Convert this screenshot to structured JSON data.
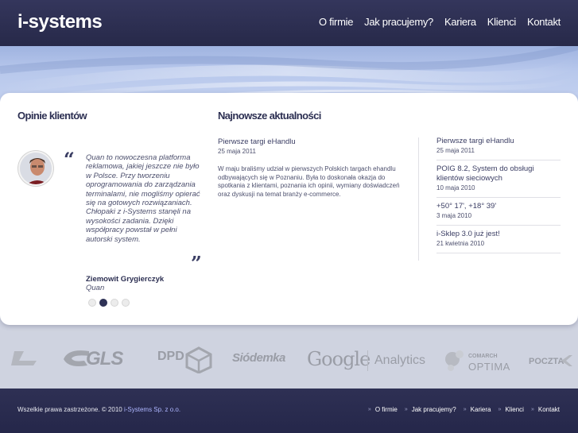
{
  "header": {
    "logo": "i-systems",
    "nav": [
      "O firmie",
      "Jak pracujemy?",
      "Kariera",
      "Klienci",
      "Kontakt"
    ]
  },
  "testimonials": {
    "title": "Opinie klientów",
    "quote": "Quan to nowoczesna platforma reklamowa, jakiej jeszcze nie było w Polsce. Przy tworzeniu oprogramowania do zarządzania terminalami, nie mogliśmy opierać się na gotowych rozwiązaniach. Chłopaki z i-Systems stanęli na wysokości zadania. Dzięki współpracy powstał w pełni autorski system.",
    "author": "Ziemowit Grygierczyk",
    "company": "Quan",
    "slide_count": 4,
    "active_slide": 2
  },
  "news": {
    "title": "Najnowsze aktualności",
    "featured": {
      "title": "Pierwsze targi eHandlu",
      "date": "25 maja 2011",
      "body": "W maju braliśmy udział w pierwszych Polskich targach ehandlu odbywających się w Poznaniu. Była to doskonała okazja do spotkania z klientami, poznania ich opinii, wymiany doświadczeń oraz dyskusji na temat branży e-commerce."
    },
    "list": [
      {
        "title": "Pierwsze targi eHandlu",
        "date": "25 maja 2011"
      },
      {
        "title": "POIG 8.2, System do obsługi klientów sieciowych",
        "date": "10 maja 2010"
      },
      {
        "title": "+50° 17', +18° 39'",
        "date": "3 maja 2010"
      },
      {
        "title": "i-Sklep 3.0 już jest!",
        "date": "21 kwietnia 2010"
      }
    ]
  },
  "clients": {
    "logos": [
      "GLS",
      "DPD",
      "Siódemka",
      "Google",
      "Analytics",
      "COMARCH",
      "OPTIMA",
      "POCZTA"
    ]
  },
  "footer": {
    "copyright_prefix": "Wszelkie prawa zastrzeżone. © 2010 ",
    "copyright_company": "i-Systems Sp. z o.o.",
    "nav": [
      "O firmie",
      "Jak pracujemy?",
      "Kariera",
      "Klienci",
      "Kontakt"
    ]
  },
  "colors": {
    "header_bg": "#2a2c4e",
    "footer_bg": "#282a4c",
    "accent_text": "#3a3d63",
    "page_bg": "#cfd3e0"
  }
}
